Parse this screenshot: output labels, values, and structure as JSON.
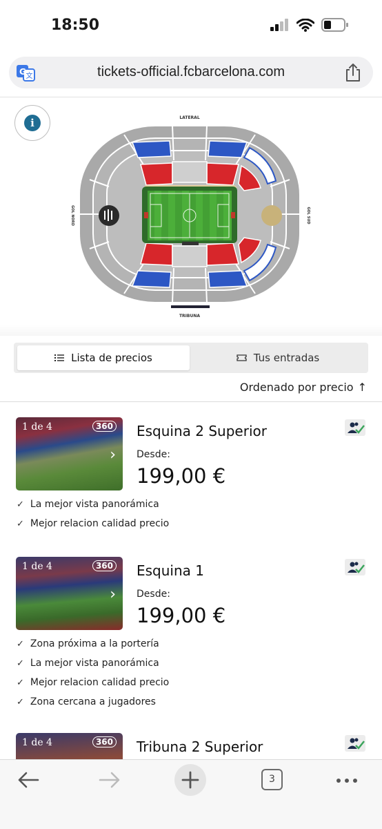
{
  "status_bar": {
    "time": "18:50"
  },
  "browser": {
    "url": "tickets-official.fcbarcelona.com",
    "open_tabs_count": "3"
  },
  "stadium_map": {
    "labels": {
      "top": "LATERAL",
      "bottom": "TRIBUNA",
      "left": "GOL NORD",
      "right": "GOL SUD"
    }
  },
  "tabs": {
    "price_list": "Lista de precios",
    "your_tickets": "Tus entradas"
  },
  "sort_label": "Ordenado por precio",
  "sort_arrow": "↑",
  "cards": [
    {
      "photo_count": "1 de 4",
      "badge_360": "360",
      "title": "Esquina 2 Superior",
      "from_label": "Desde:",
      "price": "199,00 €",
      "features": [
        "La mejor vista panorámica",
        "Mejor relacion calidad precio"
      ]
    },
    {
      "photo_count": "1 de 4",
      "badge_360": "360",
      "title": "Esquina 1",
      "from_label": "Desde:",
      "price": "199,00 €",
      "features": [
        "Zona próxima a la portería",
        "La mejor vista panorámica",
        "Mejor relacion calidad precio",
        "Zona cercana a jugadores"
      ]
    },
    {
      "photo_count": "1 de 4",
      "badge_360": "360",
      "title": "Tribuna 2 Superior"
    }
  ],
  "colors": {
    "accent_blue": "#2d57c4",
    "accent_red": "#d7262b",
    "pitch_green": "#4caf3a",
    "info_blue": "#1f6d93"
  }
}
